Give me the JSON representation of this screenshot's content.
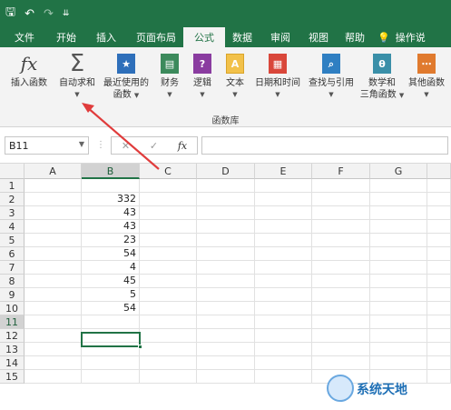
{
  "qat": {
    "save_icon": "save-icon",
    "undo": "↶",
    "redo": "↷",
    "customize": "⇊"
  },
  "tabs": [
    "文件",
    "开始",
    "插入",
    "页面布局",
    "公式",
    "数据",
    "审阅",
    "视图",
    "帮助",
    "操作说"
  ],
  "active_tab": "公式",
  "tell_me_icon": "lightbulb-icon",
  "ribbon": {
    "buttons": [
      {
        "label1": "插入函数",
        "label2": "",
        "icon": "fx"
      },
      {
        "label1": "自动求和",
        "label2": "",
        "icon": "Σ"
      },
      {
        "label1": "最近使用的",
        "label2": "函数",
        "icon": "★"
      },
      {
        "label1": "财务",
        "label2": "",
        "icon": "▤"
      },
      {
        "label1": "逻辑",
        "label2": "",
        "icon": "?"
      },
      {
        "label1": "文本",
        "label2": "",
        "icon": "A"
      },
      {
        "label1": "日期和时间",
        "label2": "",
        "icon": "▦"
      },
      {
        "label1": "查找与引用",
        "label2": "",
        "icon": "⌕"
      },
      {
        "label1": "数学和",
        "label2": "三角函数",
        "icon": "θ"
      },
      {
        "label1": "其他函数",
        "label2": "",
        "icon": "⋯"
      }
    ],
    "group_name": "函数库"
  },
  "formula_bar": {
    "name_box": "B11",
    "cancel": "✕",
    "enter": "✓",
    "fx": "fx",
    "value": ""
  },
  "columns": [
    "A",
    "B",
    "C",
    "D",
    "E",
    "F",
    "G"
  ],
  "rows": [
    "1",
    "2",
    "3",
    "4",
    "5",
    "6",
    "7",
    "8",
    "9",
    "10",
    "11",
    "12",
    "13",
    "14",
    "15"
  ],
  "column_b_values": [
    "",
    "332",
    "43",
    "43",
    "23",
    "54",
    "4",
    "45",
    "5",
    "54",
    "",
    "",
    "",
    "",
    ""
  ],
  "watermark": "系统天地",
  "colors": {
    "accent": "#217346",
    "annotation_arrow": "#e03c3c"
  }
}
